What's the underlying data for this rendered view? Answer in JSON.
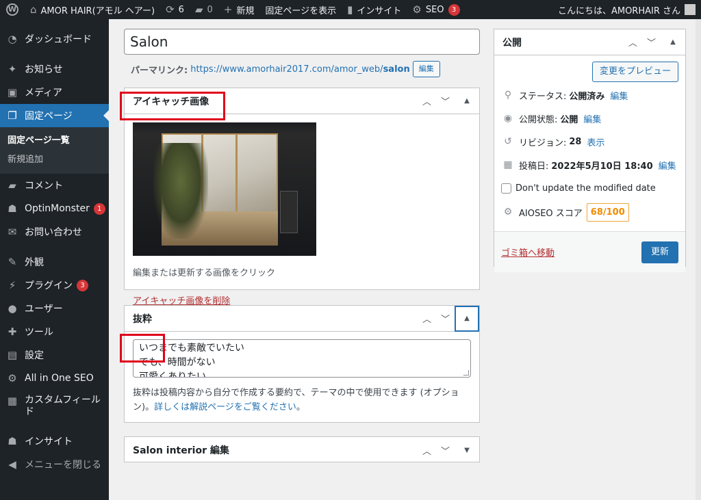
{
  "adminbar": {
    "site_name": "AMOR HAIR(アモル ヘアー)",
    "updates_count": "6",
    "comments_count": "0",
    "new_label": "新規",
    "view_page_label": "固定ページを表示",
    "insights_label": "インサイト",
    "seo_label": "SEO",
    "seo_count": "3",
    "greeting": "こんにちは、AMORHAIR さん"
  },
  "sidebar": {
    "items": [
      {
        "label": "ダッシュボード"
      },
      {
        "label": "お知らせ"
      },
      {
        "label": "メディア"
      },
      {
        "label": "固定ページ"
      },
      {
        "label": "固定ページ一覧"
      },
      {
        "label": "新規追加"
      },
      {
        "label": "コメント"
      },
      {
        "label": "OptinMonster",
        "badge": "1"
      },
      {
        "label": "お問い合わせ"
      },
      {
        "label": "外観"
      },
      {
        "label": "プラグイン",
        "badge": "3"
      },
      {
        "label": "ユーザー"
      },
      {
        "label": "ツール"
      },
      {
        "label": "設定"
      },
      {
        "label": "All in One SEO"
      },
      {
        "label": "カスタムフィールド"
      },
      {
        "label": "インサイト"
      },
      {
        "label": "メニューを閉じる"
      }
    ]
  },
  "editor": {
    "title": "Salon",
    "permalink_label": "パーマリンク:",
    "permalink_base": "https://www.amorhair2017.com/amor_web/",
    "permalink_slug": "salon",
    "edit_button": "編集"
  },
  "featured_image": {
    "title": "アイキャッチ画像",
    "help": "編集または更新する画像をクリック",
    "remove": "アイキャッチ画像を削除"
  },
  "excerpt": {
    "title": "抜粋",
    "lines": [
      "いつまでも素敵でいたい",
      "でも、時間がない",
      "可愛くありたい"
    ],
    "help_text": "抜粋は投稿内容から自分で作成する要約で、テーマの中で使用できます (オプション)。",
    "help_link": "詳しくは解説ページをご覧ください",
    "help_end": "。"
  },
  "salon_interior": {
    "title": "Salon interior 編集"
  },
  "publish": {
    "title": "公開",
    "preview": "変更をプレビュー",
    "status_label": "ステータス:",
    "status_value": "公開済み",
    "visibility_label": "公開状態:",
    "visibility_value": "公開",
    "revisions_label": "リビジョン:",
    "revisions_value": "28",
    "revisions_link": "表示",
    "date_label": "投稿日:",
    "date_value": "2022年5月10日 18:40",
    "edit_link": "編集",
    "dont_update": "Don't update the modified date",
    "aioseo_label": "AIOSEO スコア",
    "aioseo_score": "68/100",
    "trash": "ゴミ箱へ移動",
    "update": "更新"
  },
  "icons": {
    "wordpress": "wordpress-icon",
    "home": "home-icon",
    "updates": "updates-icon",
    "comments": "comment-icon",
    "plus": "plus-icon",
    "insights": "chart-icon",
    "seo": "seo-gear-icon"
  }
}
